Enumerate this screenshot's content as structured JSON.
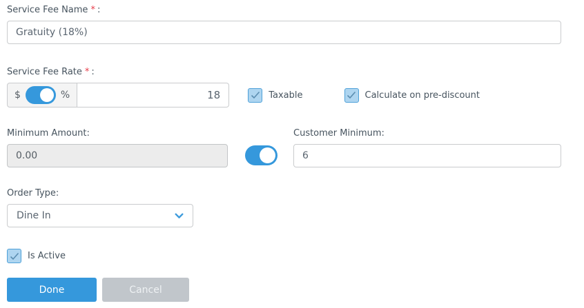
{
  "form": {
    "service_fee_name": {
      "label": "Service Fee Name",
      "required": "*",
      "colon": ":",
      "value": "Gratuity (18%)"
    },
    "service_fee_rate": {
      "label": "Service Fee Rate",
      "required": "*",
      "colon": ":",
      "dollar_label": "$",
      "percent_label": "%",
      "unit_selected": "percent",
      "value": "18"
    },
    "taxable": {
      "label": "Taxable",
      "checked": true
    },
    "calculate_on_pre_discount": {
      "label": "Calculate on pre-discount",
      "checked": true
    },
    "minimum_amount": {
      "label": "Minimum Amount:",
      "value": "0.00",
      "disabled": true
    },
    "minimum_amount_toggle": {
      "state": "on"
    },
    "customer_minimum": {
      "label": "Customer Minimum:",
      "value": "6"
    },
    "order_type": {
      "label": "Order Type:",
      "value": "Dine In"
    },
    "is_active": {
      "label": "Is Active",
      "checked": true
    },
    "actions": {
      "done": "Done",
      "cancel": "Cancel"
    }
  },
  "colors": {
    "accent_blue": "#3598dc",
    "checkbox_fill": "#aed5f0",
    "checkbox_border": "#4da0d8",
    "checkmark": "#5b8db0",
    "required_red": "#e73d4a",
    "cancel_gray": "#c1c6cb",
    "disabled_input_bg": "#ececec"
  }
}
